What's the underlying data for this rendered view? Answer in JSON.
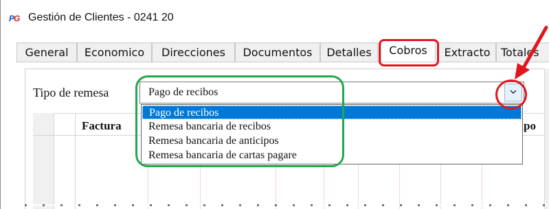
{
  "window": {
    "icon_text_p": "P",
    "icon_text_g": "G",
    "title": "Gestión de Clientes - 0241 20"
  },
  "tabs": [
    {
      "label": "General"
    },
    {
      "label": "Economico"
    },
    {
      "label": "Direcciones"
    },
    {
      "label": "Documentos"
    },
    {
      "label": "Detalles"
    },
    {
      "label": "Cobros",
      "active": true
    },
    {
      "label": "Extracto"
    },
    {
      "label": "Totales"
    }
  ],
  "form": {
    "tipo_remesa_label": "Tipo de remesa",
    "tipo_remesa_value": "Pago de recibos",
    "options": [
      {
        "label": "Pago de recibos",
        "selected": true
      },
      {
        "label": "Remesa bancaria de recibos"
      },
      {
        "label": "Remesa bancaria de anticipos"
      },
      {
        "label": "Remesa bancaria de cartas pagare"
      }
    ]
  },
  "grid": {
    "col_factura": "Factura",
    "col_anticipo": "icipo"
  },
  "icons": {
    "dropdown": "chevron-down-icon",
    "annotation_arrow": "arrow-icon"
  },
  "colors": {
    "selected_item": "#0078d7",
    "annotation_green": "#22a74a",
    "annotation_red": "#e0161e"
  }
}
